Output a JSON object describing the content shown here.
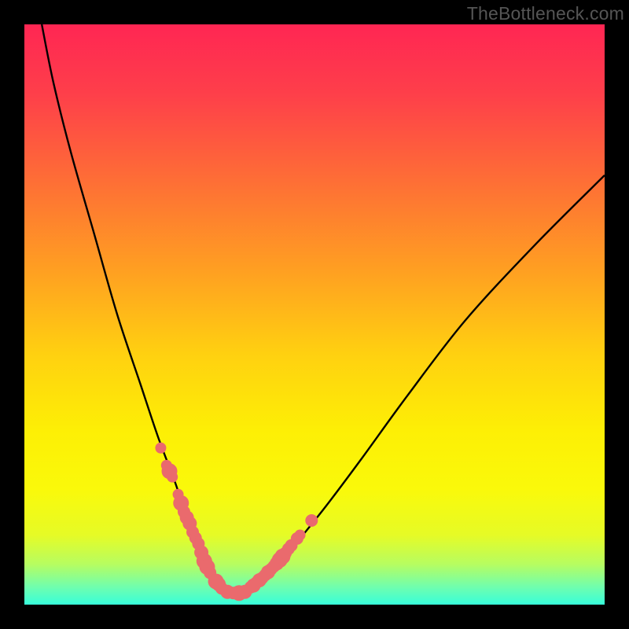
{
  "watermark": "TheBottleneck.com",
  "colors": {
    "black": "#000000",
    "curve": "#000000",
    "dot": "#ea6a6d",
    "gradient_top": "#ff2653",
    "gradient_bottom": "#37feda"
  },
  "chart_data": {
    "type": "line",
    "title": "",
    "xlabel": "",
    "ylabel": "",
    "xlim": [
      0,
      100
    ],
    "ylim": [
      0,
      100
    ],
    "annotations": [
      "TheBottleneck.com"
    ],
    "series": [
      {
        "name": "curve",
        "x": [
          3,
          5,
          8,
          12,
          16,
          20,
          23,
          26,
          28,
          30,
          32,
          33.5,
          35,
          36.5,
          38,
          41,
          44,
          48,
          52,
          58,
          66,
          76,
          88,
          100
        ],
        "y": [
          100,
          90,
          78,
          64,
          50,
          38,
          29,
          21,
          15,
          10,
          6,
          3.5,
          2,
          2,
          2.5,
          4,
          7,
          12,
          17,
          25,
          36,
          49,
          62,
          74
        ]
      }
    ],
    "highlight_dots": {
      "name": "red-dots",
      "x": [
        23.5,
        24.5,
        25,
        25.5,
        26.5,
        27,
        27.5,
        28,
        28.5,
        29,
        29.5,
        30,
        30.5,
        31,
        31.5,
        32,
        33,
        33.5,
        34,
        35,
        36,
        37,
        38,
        39,
        39.5,
        40,
        40.5,
        41,
        41.5,
        42,
        42.5,
        43,
        43.5,
        44,
        44.5,
        45,
        45.5,
        46,
        47,
        47.5,
        49.5
      ],
      "y": [
        27,
        24,
        23,
        22,
        19,
        17.5,
        16,
        15,
        14,
        12.5,
        11.5,
        10.5,
        9,
        7.5,
        6.5,
        5.5,
        4,
        3.5,
        2.8,
        2.2,
        2,
        2,
        2.2,
        3,
        3.3,
        3.8,
        4.2,
        4.6,
        5.1,
        5.6,
        6.1,
        6.6,
        7.1,
        7.7,
        8.3,
        8.9,
        9.6,
        10.2,
        11.4,
        12,
        14.5
      ],
      "r": [
        7,
        7,
        10,
        7,
        7,
        10,
        8,
        9,
        9,
        8,
        8,
        8,
        9,
        10,
        10,
        8,
        10,
        9,
        8,
        9,
        8,
        10,
        9,
        8,
        9,
        8,
        9,
        8,
        8,
        9,
        8,
        8,
        9,
        10,
        10,
        8,
        8,
        8,
        8,
        7,
        8
      ]
    }
  }
}
